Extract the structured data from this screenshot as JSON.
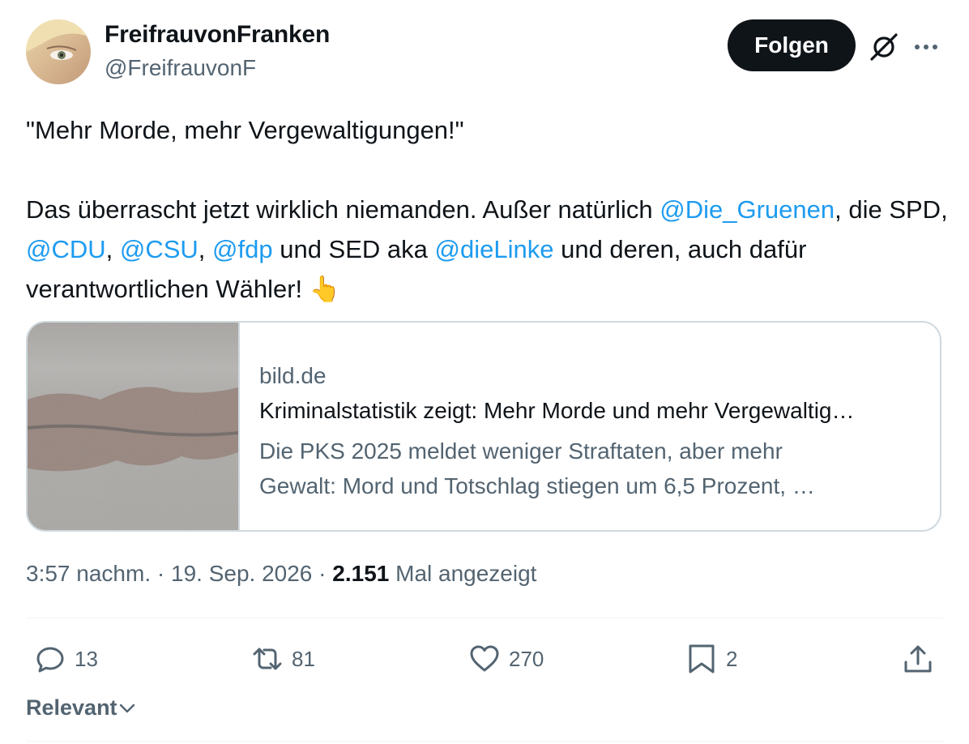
{
  "author": {
    "display_name": "FreifrauvonFranken",
    "handle": "@FreifrauvonF"
  },
  "follow_label": "Folgen",
  "tweet": {
    "line1": "\"Mehr Morde, mehr Vergewaltigungen!\"",
    "p2_a": "Das überrascht jetzt wirklich niemanden. Außer natürlich ",
    "mention_gruenen": "@Die_Gruenen",
    "p2_b": ", die SPD, ",
    "mention_cdu": "@CDU",
    "sep1": ", ",
    "mention_csu": "@CSU",
    "sep2": ", ",
    "mention_fdp": "@fdp",
    "p2_c": " und SED aka ",
    "mention_linke": "@dieLinke",
    "p2_d": " und deren, auch dafür verantwortlichen Wähler! ",
    "emoji": "👆"
  },
  "card": {
    "domain": "bild.de",
    "title": "Kriminalstatistik zeigt: Mehr Morde und mehr Vergewaltig…",
    "description_line1": "Die PKS 2025 meldet weniger Straftaten, aber mehr",
    "description_line2": "Gewalt: Mord und Totschlag stiegen um 6,5 Prozent, …"
  },
  "meta": {
    "time": "3:57 nachm.",
    "dot1": " · ",
    "date": "19. Sep. 2026",
    "dot2": " · ",
    "views": "2.151",
    "views_label": " Mal angezeigt"
  },
  "actions": {
    "replies": "13",
    "reposts": "81",
    "likes": "270",
    "bookmarks": "2"
  },
  "sort_label": "Relevant",
  "colors": {
    "text": "#0f1419",
    "secondary": "#536471",
    "link": "#1d9bf0",
    "border": "#cfd9de"
  }
}
